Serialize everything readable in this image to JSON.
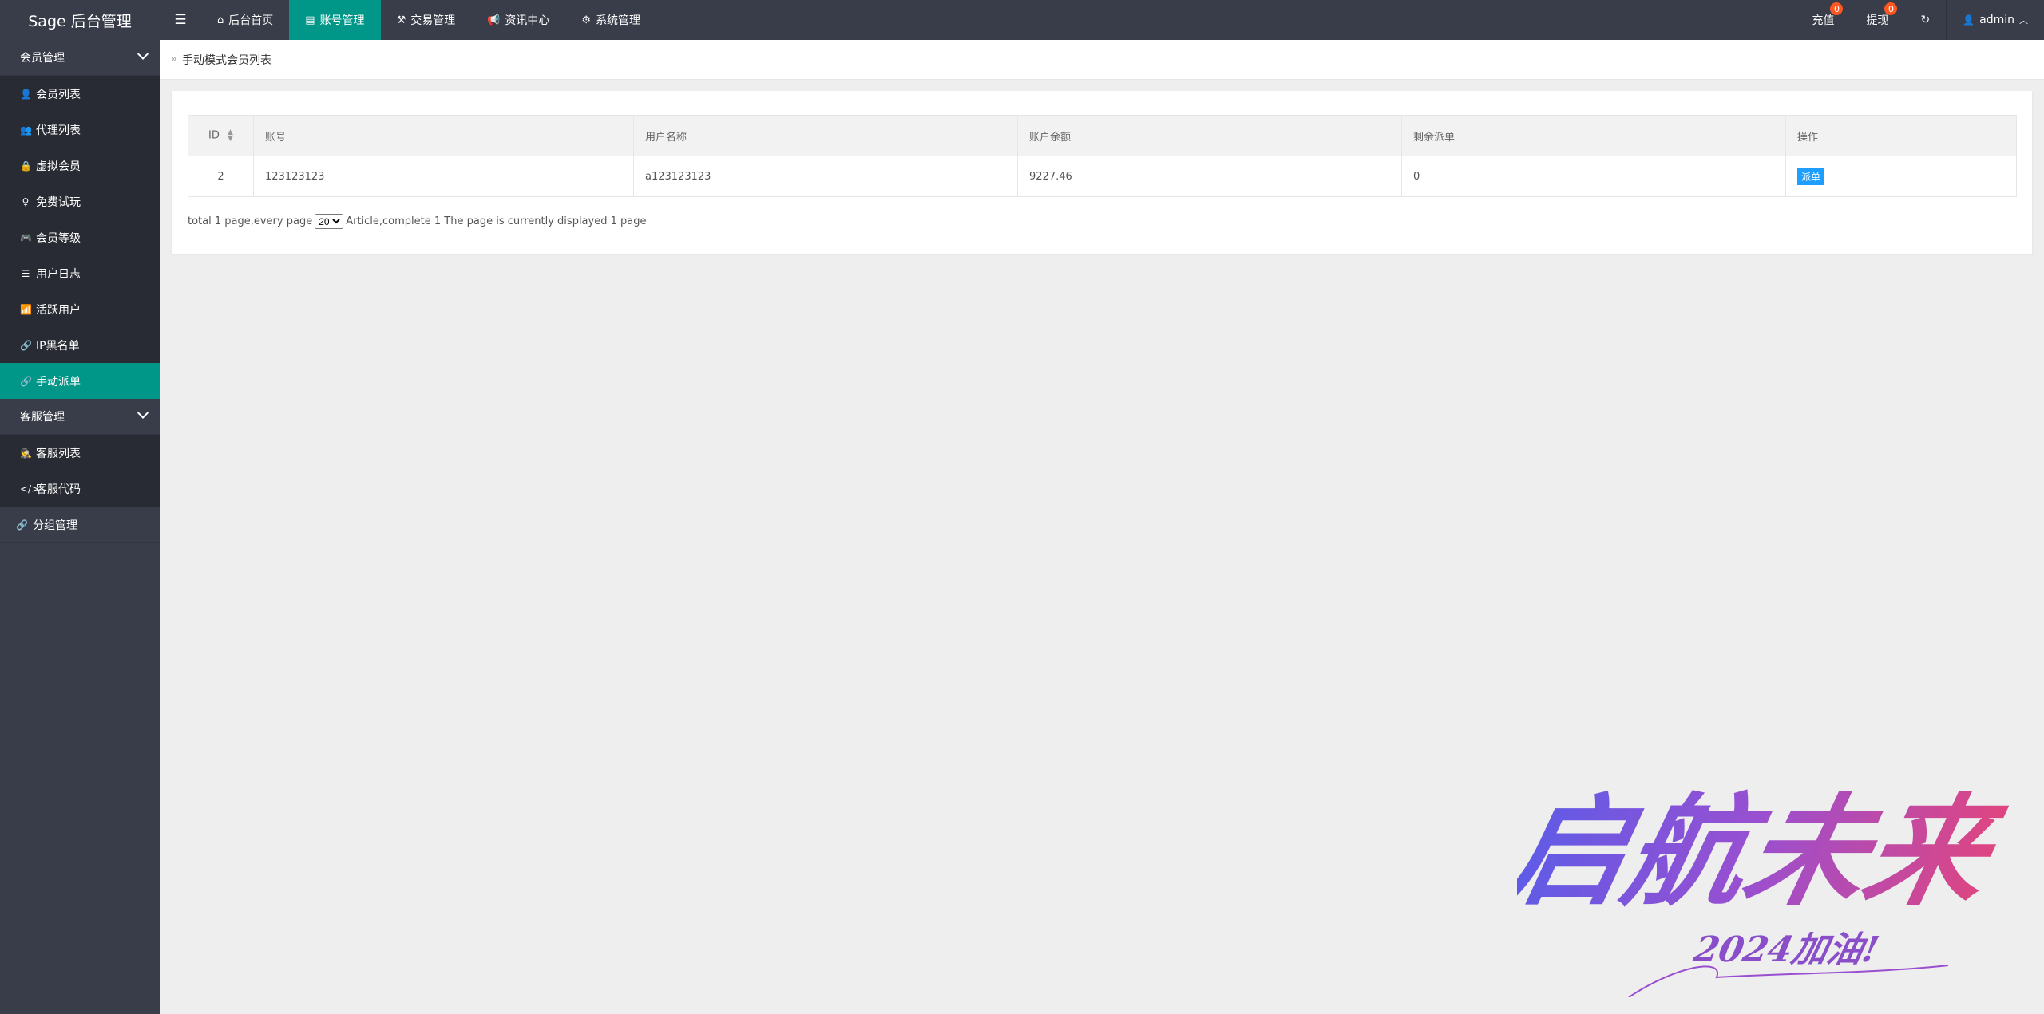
{
  "app": {
    "title": "Sage 后台管理"
  },
  "topnav": {
    "menu_icon": "hamburger-icon",
    "items": [
      {
        "label": "后台首页",
        "icon": "home-icon"
      },
      {
        "label": "账号管理",
        "icon": "id-card-icon",
        "active": true
      },
      {
        "label": "交易管理",
        "icon": "gavel-icon"
      },
      {
        "label": "资讯中心",
        "icon": "bullhorn-icon"
      },
      {
        "label": "系统管理",
        "icon": "gears-icon"
      }
    ]
  },
  "topright": {
    "recharge": {
      "label": "充值",
      "badge": "0"
    },
    "withdraw": {
      "label": "提现",
      "badge": "0"
    },
    "refresh_icon": "refresh-icon",
    "user": {
      "label": "admin",
      "icon": "user-icon"
    }
  },
  "sidebar": {
    "group1": {
      "title": "会员管理",
      "items": [
        {
          "label": "会员列表",
          "icon": "user-icon"
        },
        {
          "label": "代理列表",
          "icon": "users-icon"
        },
        {
          "label": "虚拟会员",
          "icon": "lock-icon"
        },
        {
          "label": "免费试玩",
          "icon": "female-icon"
        },
        {
          "label": "会员等级",
          "icon": "gamepad-icon"
        },
        {
          "label": "用户日志",
          "icon": "list-icon"
        },
        {
          "label": "活跃用户",
          "icon": "wifi-icon"
        },
        {
          "label": "IP黑名单",
          "icon": "link-icon"
        },
        {
          "label": "手动派单",
          "icon": "link-icon",
          "active": true
        }
      ]
    },
    "group2": {
      "title": "客服管理",
      "items": [
        {
          "label": "客服列表",
          "icon": "user-secret-icon"
        },
        {
          "label": "客服代码",
          "icon": "code-icon"
        }
      ]
    },
    "single": {
      "label": "分组管理",
      "icon": "link-icon"
    }
  },
  "breadcrumb": {
    "label": "手动模式会员列表"
  },
  "table": {
    "headers": [
      "ID",
      "账号",
      "用户名称",
      "账户余额",
      "剩余派单",
      "操作"
    ],
    "rows": [
      {
        "id": "2",
        "account": "123123123",
        "username": "a123123123",
        "balance": "9227.46",
        "remaining": "0",
        "action": "派单"
      }
    ]
  },
  "pager": {
    "prefix": "total 1 page,every page",
    "per_page": "20",
    "suffix": "Article,complete 1 The page is currently displayed 1 page"
  },
  "colors": {
    "header_bg": "#393d49",
    "active": "#009688",
    "badge": "#ff5722",
    "button": "#1e9fff"
  },
  "watermark": {
    "main": "启航未来",
    "sub": "2024加油!"
  }
}
